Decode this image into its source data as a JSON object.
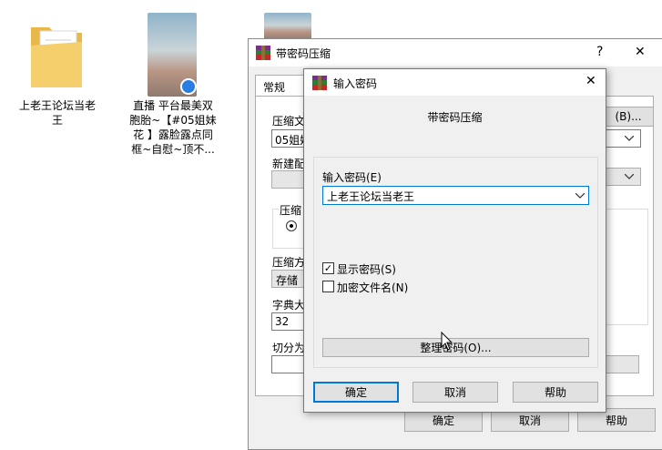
{
  "desktop": {
    "folder_label_line1": "上老王论坛当老",
    "folder_label_line2": "王",
    "video_label_line1": "直播 平台最美双",
    "video_label_line2": "胞胎~【#05姐妹",
    "video_label_line3": "花 】露脸露点同",
    "video_label_line4": "框~自慰~顶不..."
  },
  "back_window": {
    "title": "带密码压缩",
    "help_btn": "?",
    "close_btn": "✕",
    "tab_general": "常规",
    "label_archive_name": "压缩文",
    "archive_name_value": "05姐妹",
    "browse_btn": "(B)...",
    "label_profile": "新建配",
    "group_format_label": "压缩",
    "label_method": "压缩方",
    "method_value": "存储",
    "label_dict": "字典大",
    "dict_value": "32",
    "label_split": "切分为",
    "ok_btn": "确定",
    "cancel_btn": "取消",
    "help_btn2": "帮助"
  },
  "dialog": {
    "title": "输入密码",
    "close_btn": "✕",
    "header": "带密码压缩",
    "label_password": "输入密码(E)",
    "password_value": "上老王论坛当老王",
    "show_password_label": "显示密码(S)",
    "show_password_checked": true,
    "encrypt_names_label": "加密文件名(N)",
    "encrypt_names_checked": false,
    "organize_btn": "整理密码(O)...",
    "ok_btn": "确定",
    "cancel_btn": "取消",
    "help_btn": "帮助",
    "check_mark": "✓"
  }
}
